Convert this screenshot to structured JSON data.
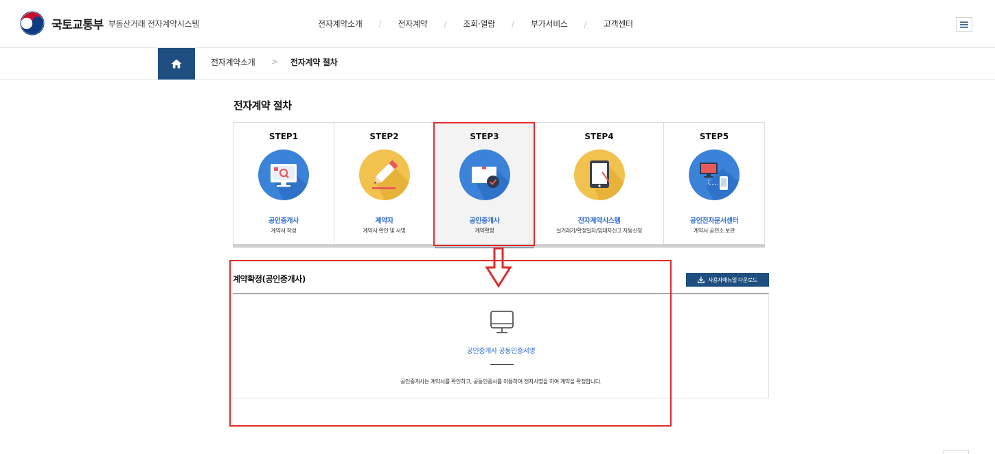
{
  "header": {
    "ministry": "국토교통부",
    "system": "부동산거래 전자계약시스템",
    "nav": [
      {
        "label": "전자계약소개"
      },
      {
        "label": "전자계약"
      },
      {
        "label": "조회·열람"
      },
      {
        "label": "부가서비스"
      },
      {
        "label": "고객센터"
      }
    ],
    "nav_separator": "/",
    "menu_icon": "hamburger-icon"
  },
  "breadcrumb": {
    "home_icon": "home-icon",
    "items": [
      "전자계약소개",
      "전자계약 절차"
    ],
    "separator": ">"
  },
  "page": {
    "title": "전자계약 절차"
  },
  "steps": [
    {
      "label": "STEP1",
      "title": "공인중개사",
      "desc": "계약서 작성",
      "icon": "monitor-search-icon",
      "circle": "#3b82d9"
    },
    {
      "label": "STEP2",
      "title": "계약자",
      "desc": "계약서 확인 및 서명",
      "icon": "pencil-sign-icon",
      "circle": "#f2c24e"
    },
    {
      "label": "STEP3",
      "title": "공인중개사",
      "desc": "계약확정",
      "icon": "document-check-icon",
      "circle": "#3b82d9",
      "active": true
    },
    {
      "label": "STEP4",
      "title": "전자계약시스템",
      "desc": "실거래가/확정일자/임대차신고 자동신청",
      "icon": "tablet-icon",
      "circle": "#f2c24e"
    },
    {
      "label": "STEP5",
      "title": "공인전자문서센터",
      "desc": "계약서 공전소 보관",
      "icon": "devices-icon",
      "circle": "#3b82d9"
    }
  ],
  "section": {
    "title": "계약확정(공인중개사)",
    "download_label": "사용자매뉴얼 다운로드",
    "subtitle": "공인중개사 공동인증서명",
    "description": "공인중개사는 계약서를 확인하고, 공동인증서를 이용하여 전자서명을 하여 계약을 확정합니다."
  },
  "colors": {
    "accent": "#1f4f80",
    "link": "#2f6ccf",
    "highlight": "#e02b2b"
  }
}
